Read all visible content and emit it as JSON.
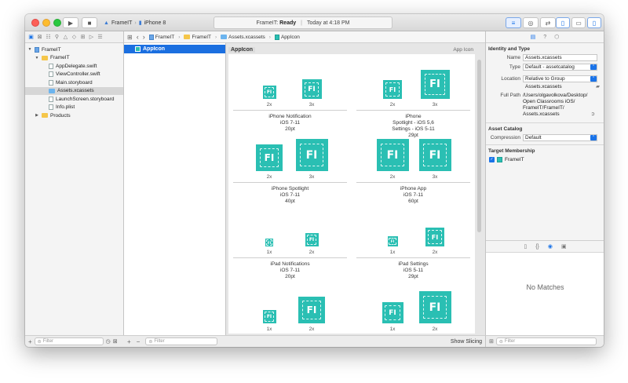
{
  "titlebar": {
    "scheme_project": "FrameIT",
    "scheme_device": "iPhone 8",
    "activity_project": "FrameIT:",
    "activity_status": "Ready",
    "activity_time": "Today at 4:18 PM"
  },
  "jumpbar": {
    "project": "FrameIT",
    "folder": "FrameIT",
    "catalog": "Assets.xcassets",
    "asset": "AppIcon"
  },
  "navigator": {
    "items": [
      {
        "label": "FrameIT",
        "indent": 0,
        "kind": "project",
        "expanded": true
      },
      {
        "label": "FrameIT",
        "indent": 1,
        "kind": "folder",
        "expanded": true
      },
      {
        "label": "AppDelegate.swift",
        "indent": 2,
        "kind": "file"
      },
      {
        "label": "ViewController.swift",
        "indent": 2,
        "kind": "file"
      },
      {
        "label": "Main.storyboard",
        "indent": 2,
        "kind": "file"
      },
      {
        "label": "Assets.xcassets",
        "indent": 2,
        "kind": "catalog",
        "selected": true
      },
      {
        "label": "LaunchScreen.storyboard",
        "indent": 2,
        "kind": "file"
      },
      {
        "label": "Info.plist",
        "indent": 2,
        "kind": "file"
      },
      {
        "label": "Products",
        "indent": 1,
        "kind": "folder",
        "expanded": false
      }
    ],
    "filter_placeholder": "Filter"
  },
  "assetlist": {
    "selected": "AppIcon",
    "filter_placeholder": "Filter",
    "add_symbol": "+",
    "remove_symbol": "−"
  },
  "canvas": {
    "asset_name": "AppIcon",
    "asset_kind": "App Icon",
    "icon_glyph": "FI",
    "show_slicing": "Show Slicing",
    "groups": [
      {
        "lines": [
          "iPhone Notification",
          "iOS 7-11",
          "20pt"
        ],
        "slots": [
          "2x",
          "3x"
        ]
      },
      {
        "lines": [
          "iPhone",
          "Spotlight - iOS 5,6",
          "Settings - iOS 5-11",
          "29pt"
        ],
        "slots": [
          "2x",
          "3x"
        ]
      },
      {
        "lines": [
          "iPhone Spotlight",
          "iOS 7-11",
          "40pt"
        ],
        "slots": [
          "2x",
          "3x"
        ]
      },
      {
        "lines": [
          "iPhone App",
          "iOS 7-11",
          "60pt"
        ],
        "slots": [
          "2x",
          "3x"
        ]
      },
      {
        "lines": [
          "iPad Notifications",
          "iOS 7-11",
          "20pt"
        ],
        "slots": [
          "1x",
          "2x"
        ]
      },
      {
        "lines": [
          "iPad Settings",
          "iOS 5-11",
          "29pt"
        ],
        "slots": [
          "1x",
          "2x"
        ]
      },
      {
        "lines": [],
        "slots": [
          "1x",
          "2x"
        ]
      },
      {
        "lines": [],
        "slots": [
          "1x",
          "2x"
        ]
      }
    ]
  },
  "inspector": {
    "identity_title": "Identity and Type",
    "name_label": "Name",
    "name_value": "Assets.xcassets",
    "type_label": "Type",
    "type_value": "Default - assetcatalog",
    "location_label": "Location",
    "location_value": "Relative to Group",
    "location_file": "Assets.xcassets",
    "fullpath_label": "Full Path",
    "fullpath_lines": [
      "/Users/olgavolkova/Desktop/",
      "Open Classrooms iOS/",
      "FrameIT/FrameIT/",
      "Assets.xcassets"
    ],
    "catalog_title": "Asset Catalog",
    "compression_label": "Compression",
    "compression_value": "Default",
    "membership_title": "Target Membership",
    "membership_target": "FrameIT",
    "no_matches": "No Matches",
    "filter_placeholder": "Filter"
  },
  "colors": {
    "accent": "#1b6fe0",
    "icon_teal": "#2abfb3"
  }
}
